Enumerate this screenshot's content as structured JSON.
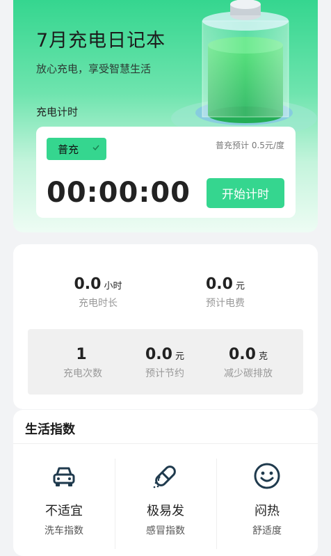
{
  "hero": {
    "title": "7月充电日记本",
    "subtitle": "放心充电，享受智慧生活",
    "section_label": "充电计时"
  },
  "timer": {
    "mode_label": "普充",
    "price_text": "普充预计 0.5元/度",
    "time": "00:00:00",
    "start_label": "开始计时"
  },
  "stats": {
    "top": [
      {
        "value": "0.0",
        "unit": "小时",
        "label": "充电时长"
      },
      {
        "value": "0.0",
        "unit": "元",
        "label": "预计电费"
      }
    ],
    "bottom": [
      {
        "value": "1",
        "unit": "",
        "label": "充电次数"
      },
      {
        "value": "0.0",
        "unit": "元",
        "label": "预计节约"
      },
      {
        "value": "0.0",
        "unit": "克",
        "label": "减少碳排放"
      }
    ]
  },
  "life": {
    "title": "生活指数",
    "items": [
      {
        "icon": "car-icon",
        "value": "不适宜",
        "label": "洗车指数"
      },
      {
        "icon": "pill-icon",
        "value": "极易发",
        "label": "感冒指数"
      },
      {
        "icon": "smiley-icon",
        "value": "闷热",
        "label": "舒适度"
      }
    ]
  },
  "colors": {
    "accent": "#35d68f",
    "icon_dark": "#1f3a4d"
  }
}
